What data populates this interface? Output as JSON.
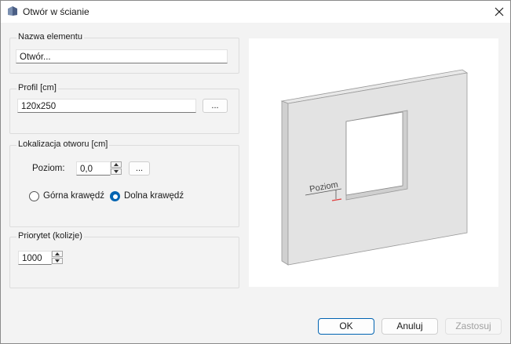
{
  "window": {
    "title": "Otwór w ścianie"
  },
  "name_group": {
    "legend": "Nazwa elementu",
    "value": "Otwór..."
  },
  "profile_group": {
    "legend": "Profil [cm]",
    "value": "120x250",
    "browse_label": "..."
  },
  "location_group": {
    "legend": "Lokalizacja otworu [cm]",
    "level_label": "Poziom:",
    "level_value": "0,0",
    "browse_label": "...",
    "radio_top": {
      "label": "Górna krawędź",
      "checked": false
    },
    "radio_bottom": {
      "label": "Dolna krawędź",
      "checked": true
    }
  },
  "priority_group": {
    "legend": "Priorytet (kolizje)",
    "value": "1000"
  },
  "preview": {
    "annotation": "Poziom"
  },
  "buttons": {
    "ok": "OK",
    "cancel": "Anuluj",
    "apply": "Zastosuj"
  },
  "colors": {
    "accent": "#0063b1",
    "marker": "#e03c3c"
  },
  "icons": [
    "app-icon",
    "close-icon",
    "spin-up-icon",
    "spin-down-icon"
  ]
}
